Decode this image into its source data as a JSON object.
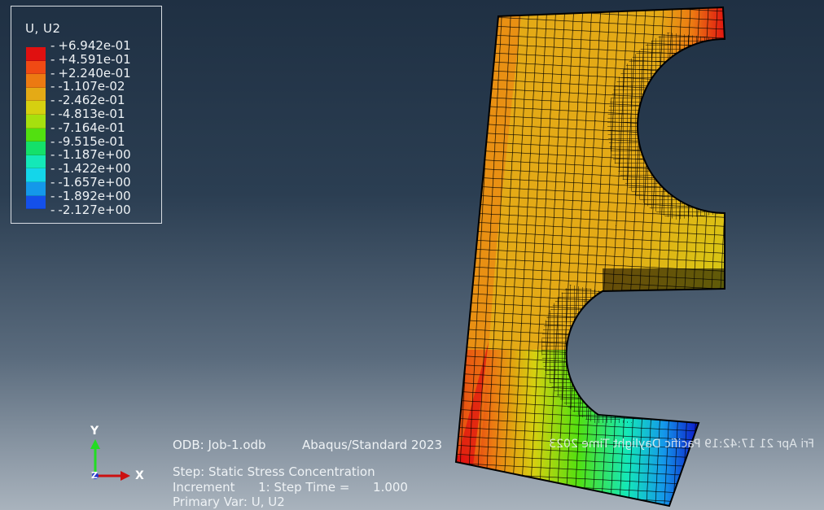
{
  "legend": {
    "title": "U, U2",
    "values": [
      "+6.942e-01",
      "+4.591e-01",
      "+2.240e-01",
      "-1.107e-02",
      "-2.462e-01",
      "-4.813e-01",
      "-7.164e-01",
      "-9.515e-01",
      "-1.187e+00",
      "-1.422e+00",
      "-1.657e+00",
      "-1.892e+00",
      "-2.127e+00"
    ],
    "colors": [
      "#e01010",
      "#f04a14",
      "#ec7a12",
      "#e4aa16",
      "#d6d010",
      "#a6e00e",
      "#52e010",
      "#14e06a",
      "#14e8b8",
      "#14d6ea",
      "#1498ea",
      "#1450ea",
      "#0c10c8"
    ]
  },
  "triad": {
    "y_label": "Y",
    "x_label": "X",
    "z_label": "Z"
  },
  "info": {
    "odb": "ODB: Job-1.odb",
    "solver": "Abaqus/Standard 2023",
    "date_mirrored": "Fri Apr 21 17:42:19 Pacific Daylight Time 2023",
    "step": "Step: Static Stress Concentration",
    "increment": "Increment      1: Step Time =      1.000",
    "primary_var": "Primary Var: U, U2"
  }
}
